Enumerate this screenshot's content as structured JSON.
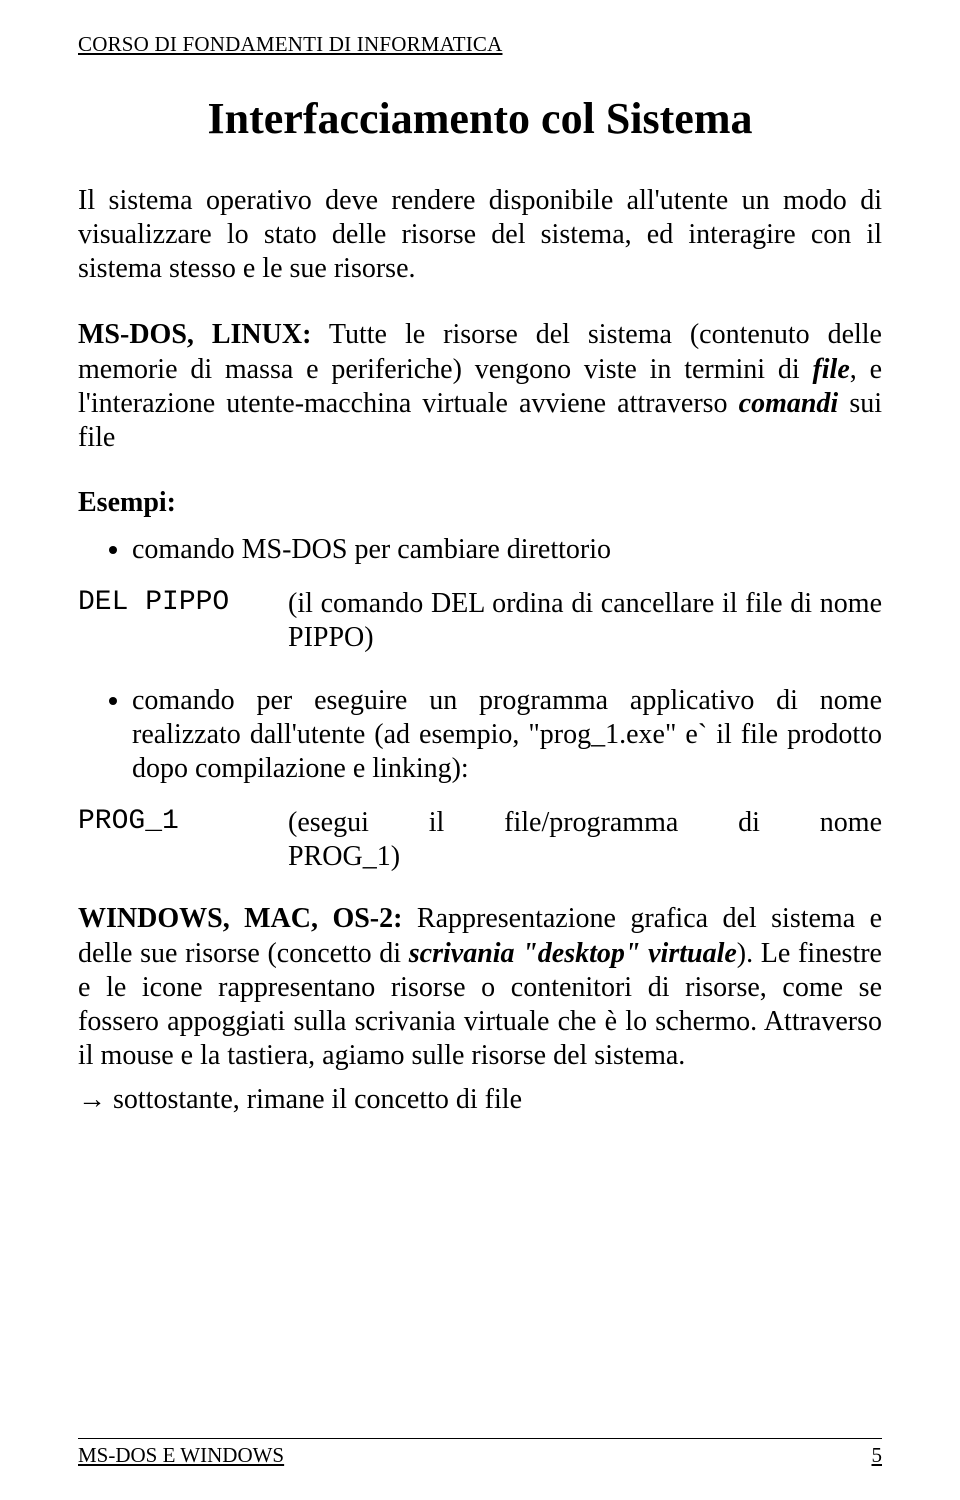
{
  "header": {
    "course": "CORSO DI FONDAMENTI DI INFORMATICA"
  },
  "title": "Interfacciamento col Sistema",
  "intro": "Il sistema operativo deve rendere disponibile all'utente un modo di visualizzare lo stato delle risorse del sistema, ed interagire con il sistema stesso e le sue risorse.",
  "msdos_linux": {
    "label": "MS-DOS, LINUX:",
    "text_part1": " Tutte le risorse del sistema (contenuto delle memorie di massa e periferiche) vengono viste in termini di ",
    "file_word": "file",
    "text_part2": ", e l'interazione utente-macchina virtuale avviene attraverso ",
    "comandi_word": "comandi",
    "text_part3": " sui file"
  },
  "esempi_label": "Esempi:",
  "bullet1": "comando MS-DOS per cambiare direttorio",
  "cmd1": {
    "cmd": "DEL PIPPO",
    "desc": "(il comando DEL ordina di cancellare il file di nome PIPPO)"
  },
  "bullet2": "comando per eseguire un programma applicativo di nome realizzato dall'utente (ad esempio, \"prog_1.exe\" e` il file prodotto dopo compilazione e linking):",
  "cmd2": {
    "cmd": "PROG_1",
    "desc1": "(esegui il file/programma di nome",
    "desc2": "PROG_1)"
  },
  "windows": {
    "label": "WINDOWS, MAC, OS-2:",
    "text_part1": " Rappresentazione grafica del sistema e delle sue risorse (concetto di ",
    "scrivania": "scrivania \"desktop\" virtuale",
    "text_part2": "). Le finestre e le icone rappresentano risorse o contenitori di risorse, come se fossero appoggiati sulla scrivania virtuale che è lo schermo. Attraverso il mouse e la tastiera,  agiamo sulle risorse del sistema."
  },
  "arrow_line": "→ sottostante, rimane il concetto di file",
  "footer": {
    "left": "MS-DOS  E WINDOWS",
    "right": "5"
  }
}
